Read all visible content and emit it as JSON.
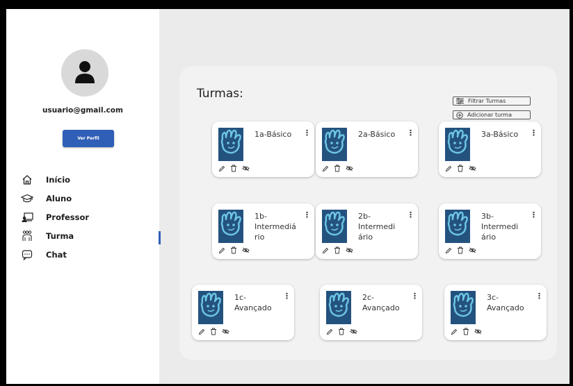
{
  "user": {
    "email": "usuario@gmail.com",
    "profile_button": "Ver Perfil"
  },
  "nav": [
    {
      "label": "Início",
      "icon": "home-icon"
    },
    {
      "label": "Aluno",
      "icon": "graduation-cap-icon"
    },
    {
      "label": "Professor",
      "icon": "teacher-board-icon"
    },
    {
      "label": "Turma",
      "icon": "group-icon"
    },
    {
      "label": "Chat",
      "icon": "chat-bubble-icon"
    }
  ],
  "active_nav": "Turma",
  "main": {
    "title": "Turmas:",
    "filter_button": "Filtrar Turmas",
    "add_button": "Adicionar turma",
    "classes": [
      {
        "name": "1a-Básico"
      },
      {
        "name": "2a-Básico"
      },
      {
        "name": "3a-Básico"
      },
      {
        "name_lines": [
          "1b-",
          "Intermediá",
          "rio"
        ]
      },
      {
        "name_lines": [
          "2b-",
          "Intermedi",
          "ário"
        ]
      },
      {
        "name_lines": [
          "3b-",
          "Intermedi",
          "ário"
        ]
      },
      {
        "name_lines": [
          "1c-",
          "Avançado"
        ]
      },
      {
        "name_lines": [
          "2c-",
          "Avançado"
        ]
      },
      {
        "name_lines": [
          "3c-",
          "Avançado"
        ]
      }
    ],
    "card_actions": [
      "pencil-icon",
      "trash-icon",
      "eye-off-icon"
    ],
    "menu_glyph": "⋮"
  },
  "colors": {
    "accent": "#2f5fb6",
    "thumb_bg": "#24527f",
    "hand": "#6ec6e6"
  }
}
